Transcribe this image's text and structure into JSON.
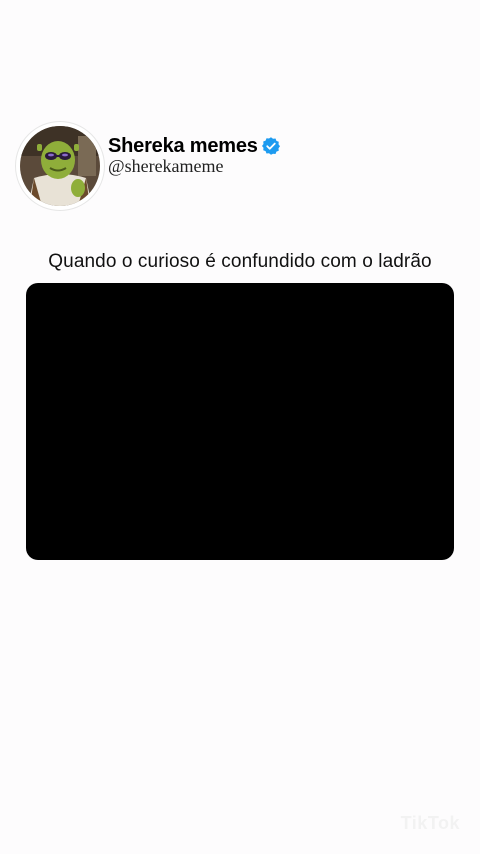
{
  "post": {
    "display_name": "Shereka memes",
    "handle": "@sherekameme",
    "caption": "Quando o curioso é confundido com o ladrão",
    "verified": true
  },
  "icons": {
    "avatar": "shrek-avatar-icon",
    "verified": "verified-badge-icon"
  },
  "colors": {
    "background": "#fdfcfd",
    "verified_badge": "#1d9bf0",
    "media_background": "#000000"
  },
  "watermark": {
    "text": "TikTok"
  }
}
